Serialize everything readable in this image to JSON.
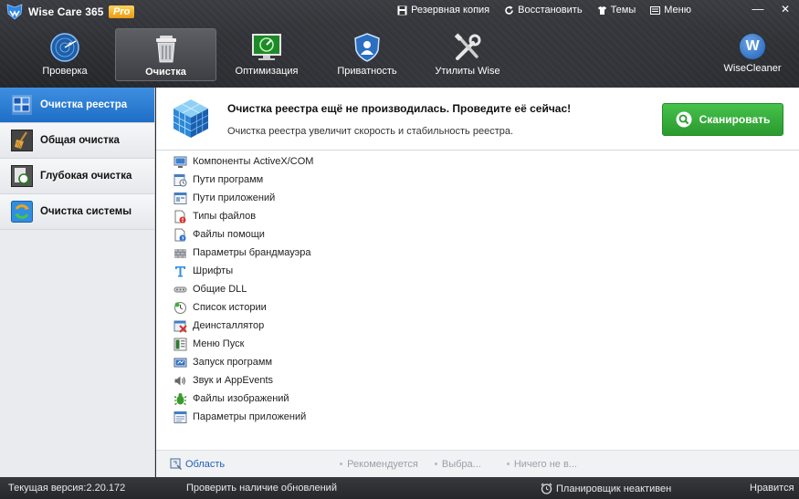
{
  "app": {
    "title": "Wise Care 365",
    "badge": "Pro"
  },
  "top_menu": [
    {
      "label": "Резервная копия",
      "icon": "save-icon"
    },
    {
      "label": "Восстановить",
      "icon": "restore-icon"
    },
    {
      "label": "Темы",
      "icon": "tshirt-icon"
    },
    {
      "label": "Меню",
      "icon": "menu-icon"
    }
  ],
  "window_controls": {
    "minimize": "—",
    "close": "✕"
  },
  "nav_tabs": [
    {
      "label": "Проверка",
      "icon": "radar-icon",
      "active": false
    },
    {
      "label": "Очистка",
      "icon": "trash-icon",
      "active": true
    },
    {
      "label": "Оптимизация",
      "icon": "monitor-gauge-icon",
      "active": false
    },
    {
      "label": "Приватность",
      "icon": "shield-user-icon",
      "active": false
    },
    {
      "label": "Утилиты Wise",
      "icon": "tools-icon",
      "active": false
    }
  ],
  "wisecleaner": {
    "label": "WiseCleaner",
    "logo": "W"
  },
  "sidebar": {
    "items": [
      {
        "label": "Очистка реестра",
        "icon": "registry-cubes-icon",
        "active": true
      },
      {
        "label": "Общая очистка",
        "icon": "broom-icon",
        "active": false
      },
      {
        "label": "Глубокая очистка",
        "icon": "deep-clean-icon",
        "active": false
      },
      {
        "label": "Очистка системы",
        "icon": "system-clean-icon",
        "active": false
      }
    ]
  },
  "banner": {
    "title": "Очистка реестра ещё не производилась. Проведите её сейчас!",
    "subtitle": "Очистка реестра увеличит скорость и стабильность реестра.",
    "scan_button": "Сканировать"
  },
  "registry_items": [
    {
      "label": "Компоненты ActiveX/COM",
      "icon": "activex-icon"
    },
    {
      "label": "Пути программ",
      "icon": "program-path-icon"
    },
    {
      "label": "Пути приложений",
      "icon": "app-path-icon"
    },
    {
      "label": "Типы файлов",
      "icon": "file-type-icon"
    },
    {
      "label": "Файлы помощи",
      "icon": "help-file-icon"
    },
    {
      "label": "Параметры брандмауэра",
      "icon": "firewall-icon"
    },
    {
      "label": "Шрифты",
      "icon": "font-icon"
    },
    {
      "label": "Общие DLL",
      "icon": "dll-icon"
    },
    {
      "label": "Список истории",
      "icon": "history-icon"
    },
    {
      "label": "Деинсталлятор",
      "icon": "uninstaller-icon"
    },
    {
      "label": "Меню Пуск",
      "icon": "start-menu-icon"
    },
    {
      "label": "Запуск программ",
      "icon": "startup-icon"
    },
    {
      "label": "Звук и AppEvents",
      "icon": "sound-icon"
    },
    {
      "label": "Файлы изображений",
      "icon": "image-file-icon"
    },
    {
      "label": "Параметры приложений",
      "icon": "app-settings-icon"
    }
  ],
  "footer": {
    "area": "Область",
    "options": [
      "Рекомендуется",
      "Выбра...",
      "Ничего не в..."
    ]
  },
  "statusbar": {
    "version": "Текущая версия:2.20.172",
    "check_updates": "Проверить наличие обновлений",
    "scheduler": "Планировщик неактивен",
    "like": "Нравится"
  },
  "colors": {
    "accent": "#2a7ed6",
    "scan_green": "#34ad39",
    "titlebar": "#2f3135"
  }
}
